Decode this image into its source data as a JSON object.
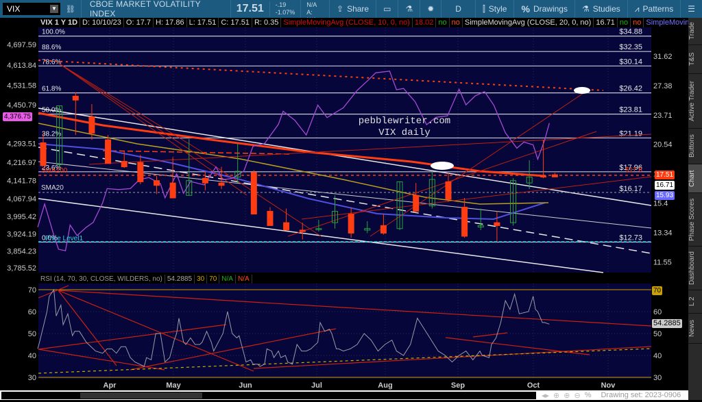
{
  "toolbar": {
    "symbol": "VIX",
    "title": "CBOE MARKET VOLATILITY INDEX",
    "last": "17.51",
    "change": "-.19",
    "change_pct": "-1.07%",
    "bid": "B: N/A",
    "ask": "A: N/A",
    "share": "Share",
    "aggregation": "D",
    "style": "Style",
    "drawings": "Drawings",
    "studies": "Studies",
    "patterns": "Patterns"
  },
  "study_row": {
    "symbol_period": "VIX 1 Y 1D",
    "date": "D: 10/10/23",
    "open": "O: 17.7",
    "high": "H: 17.86",
    "low": "L: 17.51",
    "close": "C: 17.51",
    "range": "R: 0.35",
    "sma10_label": "SimpleMovingAvg (CLOSE, 10, 0, no)",
    "sma10_value": "18.02",
    "sma10_no1": "no",
    "sma10_no2": "no",
    "sma20_label": "SimpleMovingAvg (CLOSE, 20, 0, no)",
    "sma20_value": "16.71",
    "sma20_no1": "no",
    "sma20_no2": "no",
    "sma3_label": "SimpleMoving..."
  },
  "annotations": {
    "watermark1": "pebblewriter.com",
    "watermark2": "VIX daily",
    "sma20": "SMA20",
    "sma200": "SMA200",
    "price_level": "Price Level1",
    "sma200_price": "$17.8"
  },
  "fib_levels": [
    {
      "pct": "100.0%",
      "price": "$34.88",
      "value": 34.88
    },
    {
      "pct": "88.6%",
      "price": "$32.35",
      "value": 32.35
    },
    {
      "pct": "78.6%",
      "price": "$30.14",
      "value": 30.14
    },
    {
      "pct": "61.8%",
      "price": "$26.42",
      "value": 26.42
    },
    {
      "pct": "50.0%",
      "price": "$23.81",
      "value": 23.81
    },
    {
      "pct": "38.2%",
      "price": "$21.19",
      "value": 21.19
    },
    {
      "pct": "23.6%",
      "price": "$17.96",
      "value": 17.96
    },
    {
      "pct": "0.0%",
      "price": "$12.73",
      "value": 12.73
    }
  ],
  "sma20_level": {
    "price": "$16.17",
    "value": 16.17
  },
  "right_axis": [
    "31.62",
    "27.38",
    "23.71",
    "20.54",
    "17.79",
    "15.4",
    "13.34",
    "11.55"
  ],
  "left_axis": [
    "4,697.59",
    "4,613.84",
    "4,531.58",
    "4,450.79",
    "4,293.51",
    "4,216.97",
    "4,141.78",
    "4,067.94",
    "3,995.42",
    "3,924.19",
    "3,854.23",
    "3,785.52"
  ],
  "badges": {
    "last": "17.51",
    "sma20": "16.71",
    "sma3": "15.93",
    "spx": "4,376.75",
    "rsi": "54.2885",
    "rsi_70": "70"
  },
  "colors": {
    "up": "#27a33a",
    "down": "#ff3d12",
    "bg": "#06063a",
    "spx": "#a64ad6",
    "sma200": "#ff3d12",
    "sma_blue": "#5050e0"
  },
  "rsi_header": {
    "label": "RSI (14, 70, 30, CLOSE, WILDERS, no)",
    "value": "54.2885",
    "os": "30",
    "ob": "70",
    "na1": "N/A",
    "na2": "N/A"
  },
  "rsi_axis": [
    "70",
    "60",
    "50",
    "40",
    "30"
  ],
  "months": [
    "Apr",
    "May",
    "Jun",
    "Jul",
    "Aug",
    "Sep",
    "Oct",
    "Nov"
  ],
  "sidebar": [
    "Trade",
    "T&S",
    "Active Trader",
    "Buttons",
    "Chart",
    "Phase Scores",
    "Dashboard",
    "L 2",
    "News"
  ],
  "sidebar_selected": "Chart",
  "bottom": {
    "drawing_set": "Drawing set: 2023-0906"
  },
  "chart_data": {
    "type": "candlestick",
    "title": "VIX 1 Y 1D",
    "x_unit": "days since 2023-03-01",
    "yscale": "log",
    "ylim": [
      10.9,
      36
    ],
    "candles_weekly": [
      [
        0,
        20.7,
        21.7,
        18.5,
        18.5
      ],
      [
        7,
        18.6,
        24.8,
        18.3,
        24.8
      ],
      [
        14,
        26.0,
        26.5,
        21.5,
        25.5
      ],
      [
        21,
        23.5,
        25.0,
        21.0,
        21.7
      ],
      [
        28,
        21.0,
        21.5,
        18.7,
        18.7
      ],
      [
        35,
        18.9,
        19.9,
        18.3,
        18.4
      ],
      [
        42,
        18.8,
        19.5,
        16.9,
        17.1
      ],
      [
        49,
        17.2,
        17.6,
        16.1,
        16.8
      ],
      [
        56,
        17.0,
        19.3,
        15.8,
        15.8
      ],
      [
        63,
        16.0,
        21.1,
        16.0,
        17.2
      ],
      [
        70,
        17.4,
        18.0,
        16.4,
        17.0
      ],
      [
        77,
        17.0,
        18.4,
        16.5,
        16.8
      ],
      [
        84,
        17.5,
        20.6,
        17.0,
        18.0
      ],
      [
        91,
        17.9,
        18.1,
        14.6,
        14.6
      ],
      [
        98,
        14.8,
        15.1,
        13.8,
        13.8
      ],
      [
        105,
        14.0,
        15.0,
        13.5,
        13.5
      ],
      [
        112,
        13.5,
        14.0,
        12.9,
        13.4
      ],
      [
        119,
        13.6,
        14.2,
        13.4,
        13.6
      ],
      [
        126,
        14.0,
        16.0,
        13.6,
        14.8
      ],
      [
        133,
        14.6,
        15.1,
        13.0,
        13.3
      ],
      [
        140,
        13.5,
        14.1,
        13.3,
        13.6
      ],
      [
        147,
        13.8,
        14.6,
        13.2,
        13.3
      ],
      [
        154,
        13.6,
        17.1,
        13.5,
        17.1
      ],
      [
        161,
        16.0,
        17.0,
        14.8,
        14.8
      ],
      [
        168,
        15.2,
        18.0,
        15.0,
        17.3
      ],
      [
        175,
        17.1,
        17.9,
        15.5,
        15.7
      ],
      [
        182,
        15.1,
        15.8,
        13.0,
        13.1
      ],
      [
        189,
        13.7,
        15.0,
        13.5,
        13.8
      ],
      [
        196,
        14.0,
        14.8,
        12.8,
        13.8
      ],
      [
        203,
        14.0,
        17.4,
        13.8,
        17.2
      ],
      [
        210,
        17.0,
        19.0,
        16.5,
        17.5
      ],
      [
        216,
        17.6,
        21.0,
        17.4,
        17.5
      ],
      [
        221,
        17.7,
        17.86,
        17.51,
        17.51
      ]
    ],
    "spx_overlay": [
      [
        0,
        3951
      ],
      [
        3,
        4046
      ],
      [
        7,
        3918
      ],
      [
        9,
        3861
      ],
      [
        12,
        3855
      ],
      [
        14,
        3960
      ],
      [
        17,
        3917
      ],
      [
        21,
        3951
      ],
      [
        24,
        3971
      ],
      [
        28,
        4050
      ],
      [
        30,
        4109
      ],
      [
        35,
        4105
      ],
      [
        40,
        4109
      ],
      [
        44,
        4146
      ],
      [
        48,
        4154
      ],
      [
        53,
        4129
      ],
      [
        55,
        4071
      ],
      [
        60,
        4169
      ],
      [
        63,
        4090
      ],
      [
        66,
        4138
      ],
      [
        72,
        4124
      ],
      [
        77,
        4198
      ],
      [
        80,
        4145
      ],
      [
        84,
        4151
      ],
      [
        89,
        4180
      ],
      [
        93,
        4282
      ],
      [
        98,
        4293
      ],
      [
        104,
        4372
      ],
      [
        106,
        4425
      ],
      [
        111,
        4389
      ],
      [
        116,
        4328
      ],
      [
        121,
        4450
      ],
      [
        125,
        4399
      ],
      [
        132,
        4439
      ],
      [
        138,
        4510
      ],
      [
        143,
        4554
      ],
      [
        146,
        4582
      ],
      [
        152,
        4589
      ],
      [
        155,
        4513
      ],
      [
        158,
        4518
      ],
      [
        163,
        4464
      ],
      [
        168,
        4370
      ],
      [
        172,
        4400
      ],
      [
        177,
        4406
      ],
      [
        182,
        4515
      ],
      [
        185,
        4451
      ],
      [
        189,
        4488
      ],
      [
        193,
        4505
      ],
      [
        197,
        4450
      ],
      [
        202,
        4337
      ],
      [
        207,
        4274
      ],
      [
        210,
        4299
      ],
      [
        214,
        4288
      ],
      [
        216,
        4229
      ],
      [
        219,
        4308
      ],
      [
        221,
        4376.75
      ]
    ],
    "rsi": [
      [
        0,
        43
      ],
      [
        1,
        47
      ],
      [
        4,
        60
      ],
      [
        5,
        67
      ],
      [
        7,
        70
      ],
      [
        8,
        58
      ],
      [
        10,
        63
      ],
      [
        11,
        54
      ],
      [
        13,
        59
      ],
      [
        15,
        49
      ],
      [
        16,
        51
      ],
      [
        18,
        51
      ],
      [
        21,
        46
      ],
      [
        25,
        42
      ],
      [
        28,
        41
      ],
      [
        30,
        43
      ],
      [
        32,
        43
      ],
      [
        34,
        41
      ],
      [
        36,
        44
      ],
      [
        38,
        44
      ],
      [
        40,
        39
      ],
      [
        42,
        37
      ],
      [
        44,
        36
      ],
      [
        46,
        35
      ],
      [
        47,
        39
      ],
      [
        49,
        38
      ],
      [
        51,
        50
      ],
      [
        53,
        50
      ],
      [
        55,
        37
      ],
      [
        57,
        39
      ],
      [
        59,
        47
      ],
      [
        60,
        50
      ],
      [
        61,
        57
      ],
      [
        63,
        46
      ],
      [
        64,
        45
      ],
      [
        66,
        48
      ],
      [
        68,
        45
      ],
      [
        70,
        45
      ],
      [
        71,
        46
      ],
      [
        73,
        51
      ],
      [
        75,
        46
      ],
      [
        76,
        42
      ],
      [
        78,
        46
      ],
      [
        80,
        50
      ],
      [
        82,
        60
      ],
      [
        84,
        50
      ],
      [
        86,
        48
      ],
      [
        87,
        49
      ],
      [
        89,
        41
      ],
      [
        90,
        37
      ],
      [
        92,
        38
      ],
      [
        93,
        36
      ],
      [
        95,
        36
      ],
      [
        96,
        35
      ],
      [
        98,
        36
      ],
      [
        99,
        43
      ],
      [
        101,
        42
      ],
      [
        102,
        39
      ],
      [
        104,
        42
      ],
      [
        105,
        39
      ],
      [
        107,
        40
      ],
      [
        108,
        37
      ],
      [
        110,
        36
      ],
      [
        112,
        45
      ],
      [
        114,
        42
      ],
      [
        116,
        42
      ],
      [
        118,
        43
      ],
      [
        121,
        46
      ],
      [
        122,
        55
      ],
      [
        124,
        51
      ],
      [
        126,
        52
      ],
      [
        127,
        50
      ],
      [
        129,
        43
      ],
      [
        130,
        43
      ],
      [
        132,
        42
      ],
      [
        135,
        43
      ],
      [
        138,
        45
      ],
      [
        141,
        50
      ],
      [
        144,
        47
      ],
      [
        147,
        42
      ],
      [
        150,
        45
      ],
      [
        153,
        47
      ],
      [
        155,
        42
      ],
      [
        158,
        40
      ],
      [
        161,
        45
      ],
      [
        164,
        57
      ],
      [
        167,
        52
      ],
      [
        170,
        47
      ],
      [
        173,
        42
      ],
      [
        176,
        40
      ],
      [
        179,
        37
      ],
      [
        182,
        40
      ],
      [
        185,
        42
      ],
      [
        188,
        38
      ],
      [
        191,
        42
      ],
      [
        192,
        40
      ],
      [
        195,
        39
      ],
      [
        196,
        45
      ],
      [
        198,
        48
      ],
      [
        200,
        55
      ],
      [
        202,
        65
      ],
      [
        204,
        61
      ],
      [
        206,
        68
      ],
      [
        208,
        59
      ],
      [
        212,
        60
      ],
      [
        214,
        67
      ],
      [
        215,
        61
      ],
      [
        216,
        60
      ],
      [
        218,
        55
      ],
      [
        219,
        55
      ],
      [
        221,
        54.2885
      ]
    ],
    "rsi_ylim": [
      30,
      70
    ]
  }
}
